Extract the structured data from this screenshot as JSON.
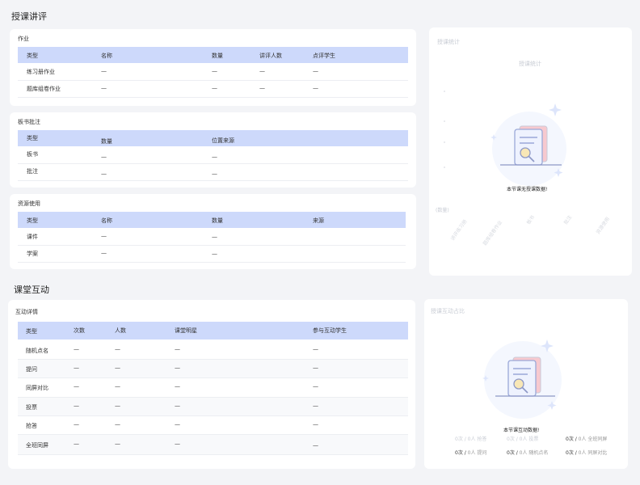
{
  "teaching": {
    "section_title": "授课讲评",
    "homework": {
      "title": "作业",
      "columns": [
        "类型",
        "名称",
        "数量",
        "讲评人数",
        "点评学生"
      ],
      "rows": [
        [
          "练习册作业",
          "—",
          "—",
          "—",
          "—"
        ],
        [
          "题库组卷作业",
          "—",
          "—",
          "—",
          "—"
        ]
      ]
    },
    "board": {
      "title": "板书批注",
      "columns": [
        "类型",
        "数量",
        "位置来源"
      ],
      "rows": [
        [
          "板书",
          "—",
          "—"
        ],
        [
          "批注",
          "—",
          "—"
        ]
      ]
    },
    "resources": {
      "title": "资源使用",
      "columns": [
        "类型",
        "名称",
        "数量",
        "来源"
      ],
      "rows": [
        [
          "课件",
          "—",
          "—",
          ""
        ],
        [
          "学案",
          "—",
          "—",
          ""
        ]
      ]
    },
    "stats": {
      "title": "授课统计",
      "chart_title": "授课统计",
      "y_unit": "(数量)",
      "empty_text": "本节课无授课数据!",
      "x_labels": [
        "讲评练习册",
        "题库组卷作业",
        "板书",
        "批注",
        "资源使用"
      ]
    }
  },
  "interaction": {
    "section_title": "课堂互动",
    "details": {
      "title": "互动详情",
      "columns": [
        "类型",
        "次数",
        "人数",
        "课堂明星",
        "参与互动学生"
      ],
      "rows": [
        [
          "随机点名",
          "—",
          "—",
          "—",
          "—"
        ],
        [
          "提问",
          "—",
          "—",
          "—",
          "—"
        ],
        [
          "同屏对比",
          "—",
          "—",
          "—",
          "—"
        ],
        [
          "投票",
          "—",
          "—",
          "—",
          "—"
        ],
        [
          "抢答",
          "—",
          "—",
          "—",
          "—"
        ],
        [
          "全班同屏",
          "—",
          "—",
          "—",
          "—"
        ]
      ]
    },
    "ratio": {
      "title": "授课互动占比",
      "empty_text": "本节课互动数据!",
      "stats": [
        {
          "count": "0次",
          "people": "0人",
          "label": "抢答",
          "faint": true
        },
        {
          "count": "0次",
          "people": "0人",
          "label": "投票",
          "faint": true
        },
        {
          "count": "0次",
          "people": "0人",
          "label": "全班同屏",
          "faint": false
        },
        {
          "count": "0次",
          "people": "0人",
          "label": "提问",
          "faint": false
        },
        {
          "count": "0次",
          "people": "0人",
          "label": "随机点名",
          "faint": false
        },
        {
          "count": "0次",
          "people": "0人",
          "label": "同屏对比",
          "faint": false
        }
      ]
    }
  }
}
